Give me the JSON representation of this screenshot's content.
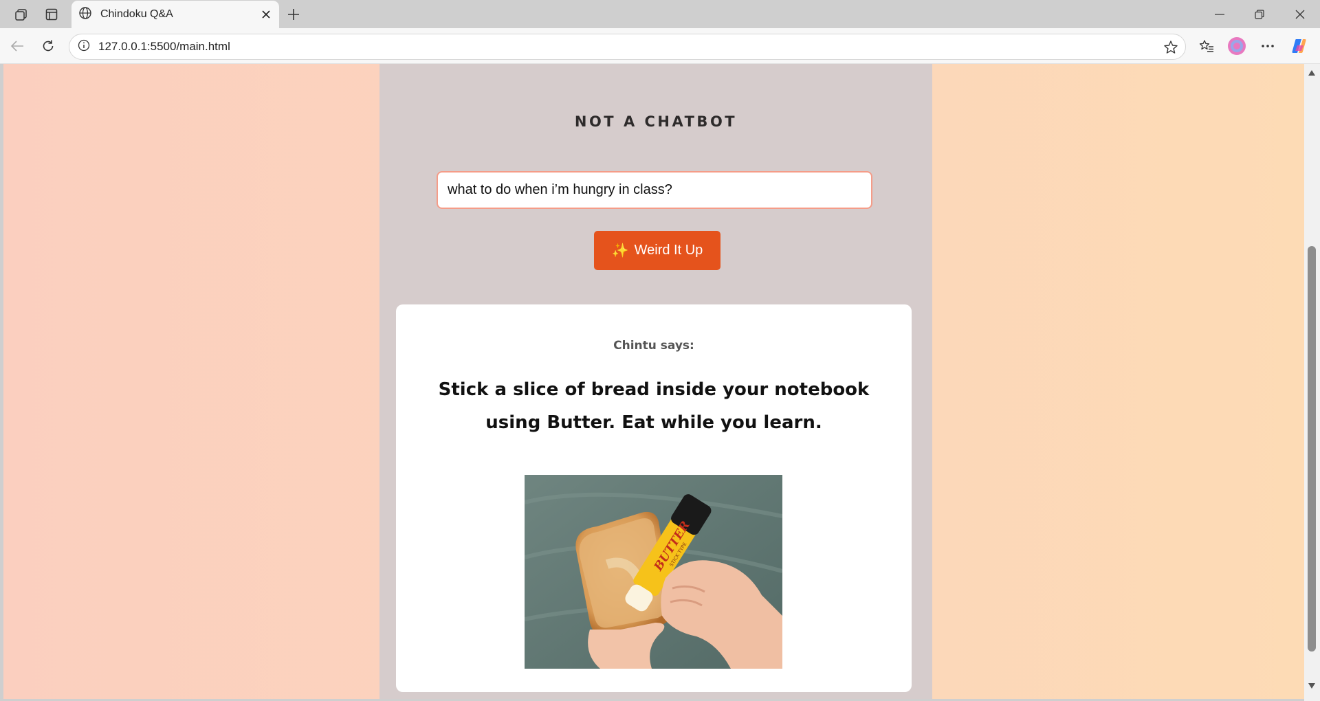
{
  "browser": {
    "tab_title": "Chindoku Q&A",
    "url": "127.0.0.1:5500/main.html"
  },
  "page": {
    "heading": "NOT A CHATBOT",
    "question_value": "what to do when i’m hungry in class?",
    "button_label": "Weird It Up",
    "button_icon": "sparkles-icon",
    "speaker": "Chintu says:",
    "answer": "Stick a slice of bread inside your notebook using Butter. Eat while you learn.",
    "image_label_main": "BUTTER",
    "image_label_sub": "STICK TYPE"
  },
  "colors": {
    "accent": "#e5531c",
    "input_border": "#f59c88",
    "center_column": "#d6cccc",
    "bg_left": "#fbcfbf",
    "bg_right": "#fddbb5"
  }
}
